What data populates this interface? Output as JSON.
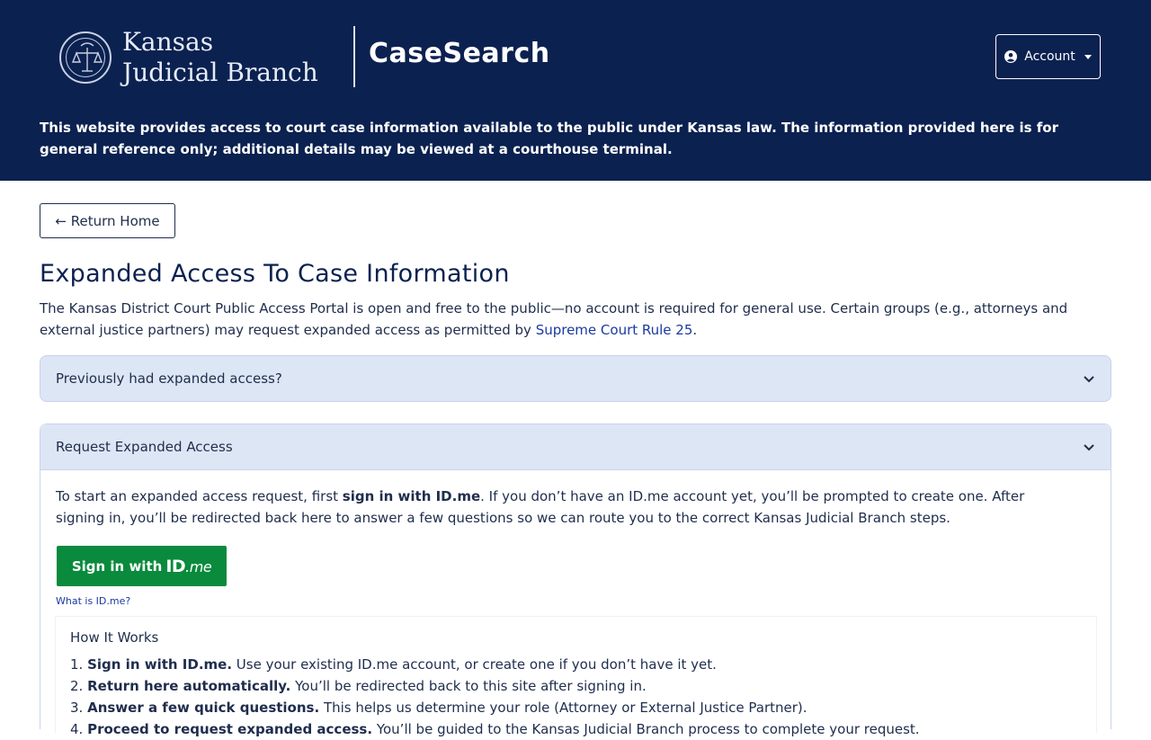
{
  "header": {
    "brand_line1": "Kansas",
    "brand_line2": "Judicial Branch",
    "app_title": "CaseSearch",
    "account_label": "Account",
    "notice": "This website provides access to court case information available to the public under Kansas law. The information provided here is for general reference only; additional details may be viewed at a courthouse terminal."
  },
  "main": {
    "return_label": "← Return Home",
    "page_title": "Expanded Access To Case Information",
    "intro_text": "The Kansas District Court Public Access Portal is open and free to the public—no account is required for general use. Certain groups (e.g., attorneys and external justice partners) may request expanded access as permitted by ",
    "intro_link": "Supreme Court Rule 25",
    "intro_end": "."
  },
  "accordion": {
    "previous_title": "Previously had expanded access?",
    "request_title": "Request Expanded Access",
    "request_text_1": "To start an expanded access request, first ",
    "request_text_bold": "sign in with ID.me",
    "request_text_2": ". If you don’t have an ID.me account yet, you’ll be prompted to create one. After signing in, you’ll be redirected back here to answer a few questions so we can route you to the correct Kansas Judicial Branch steps.",
    "idme_prefix": "Sign in with",
    "idme_logo_id": "ID",
    "idme_logo_me": ".me",
    "what_idme": "What is ID.me?"
  },
  "how_it_works": {
    "title": "How It Works",
    "steps": [
      {
        "num": "1.",
        "bold": "Sign in with ID.me.",
        "text": " Use your existing ID.me account, or create one if you don’t have it yet."
      },
      {
        "num": "2.",
        "bold": "Return here automatically.",
        "text": " You’ll be redirected back to this site after signing in."
      },
      {
        "num": "3.",
        "bold": "Answer a few quick questions.",
        "text": " This helps us determine your role (Attorney or External Justice Partner)."
      },
      {
        "num": "4.",
        "bold": "Proceed to request expanded access.",
        "text": " You’ll be guided to the Kansas Judicial Branch process to complete your request."
      }
    ]
  },
  "colors": {
    "header_bg": "#0b2150",
    "accordion_bg": "#dde6f4",
    "idme_green": "#0a8a3d",
    "link": "#1a3aa0"
  },
  "icons": {
    "seal": "scales-seal-icon",
    "user": "user-circle-icon",
    "chevron": "chevron-down-icon"
  }
}
